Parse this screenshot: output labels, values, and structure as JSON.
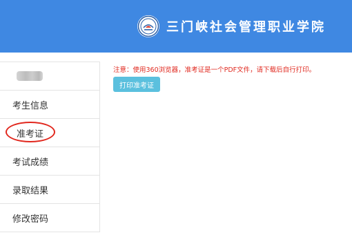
{
  "header": {
    "school_name": "三门峡社会管理职业学院",
    "background_color": "#3f88e2",
    "logo_icon": "school-emblem-icon"
  },
  "sidebar": {
    "items": [
      {
        "label": "考生信息"
      },
      {
        "label": "准考证"
      },
      {
        "label": "考试成绩"
      },
      {
        "label": "录取结果"
      },
      {
        "label": "修改密码"
      }
    ],
    "highlight_color": "#e1261c"
  },
  "main": {
    "notice": "注意：使用360浏览器，准考证是一个PDF文件，请下载后自行打印。",
    "notice_color": "#e02a20",
    "print_button_label": "打印准考证",
    "print_button_color": "#5bc0de"
  }
}
